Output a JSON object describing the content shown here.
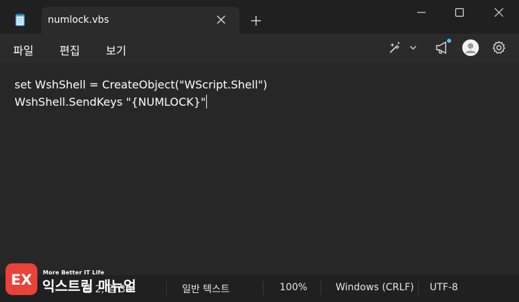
{
  "window": {
    "tab_title": "numlock.vbs",
    "icons": [
      "notepad-icon",
      "close-icon",
      "plus-icon",
      "minimize-icon",
      "maximize-icon",
      "close-window-icon"
    ]
  },
  "menu": {
    "file": "파일",
    "edit": "편집",
    "view": "보기"
  },
  "toolbar": {
    "icons": [
      "copilot-icon",
      "chevron-down-icon",
      "megaphone-icon",
      "avatar-icon",
      "gear-icon"
    ],
    "notification_dot_color": "#4cc2ff"
  },
  "editor": {
    "lines": [
      "set WshShell = CreateObject(\"WScript.Shell\")",
      "WshShell.SendKeys \"{NUMLOCK}\""
    ]
  },
  "status": {
    "position": "줄 2, 열 30",
    "mode": "일반 텍스트",
    "zoom": "100%",
    "line_ending": "Windows (CRLF)",
    "encoding": "UTF-8"
  },
  "watermark": {
    "logo_text": "EX",
    "tagline": "More Better IT Life",
    "name": "익스트림 매뉴얼"
  }
}
